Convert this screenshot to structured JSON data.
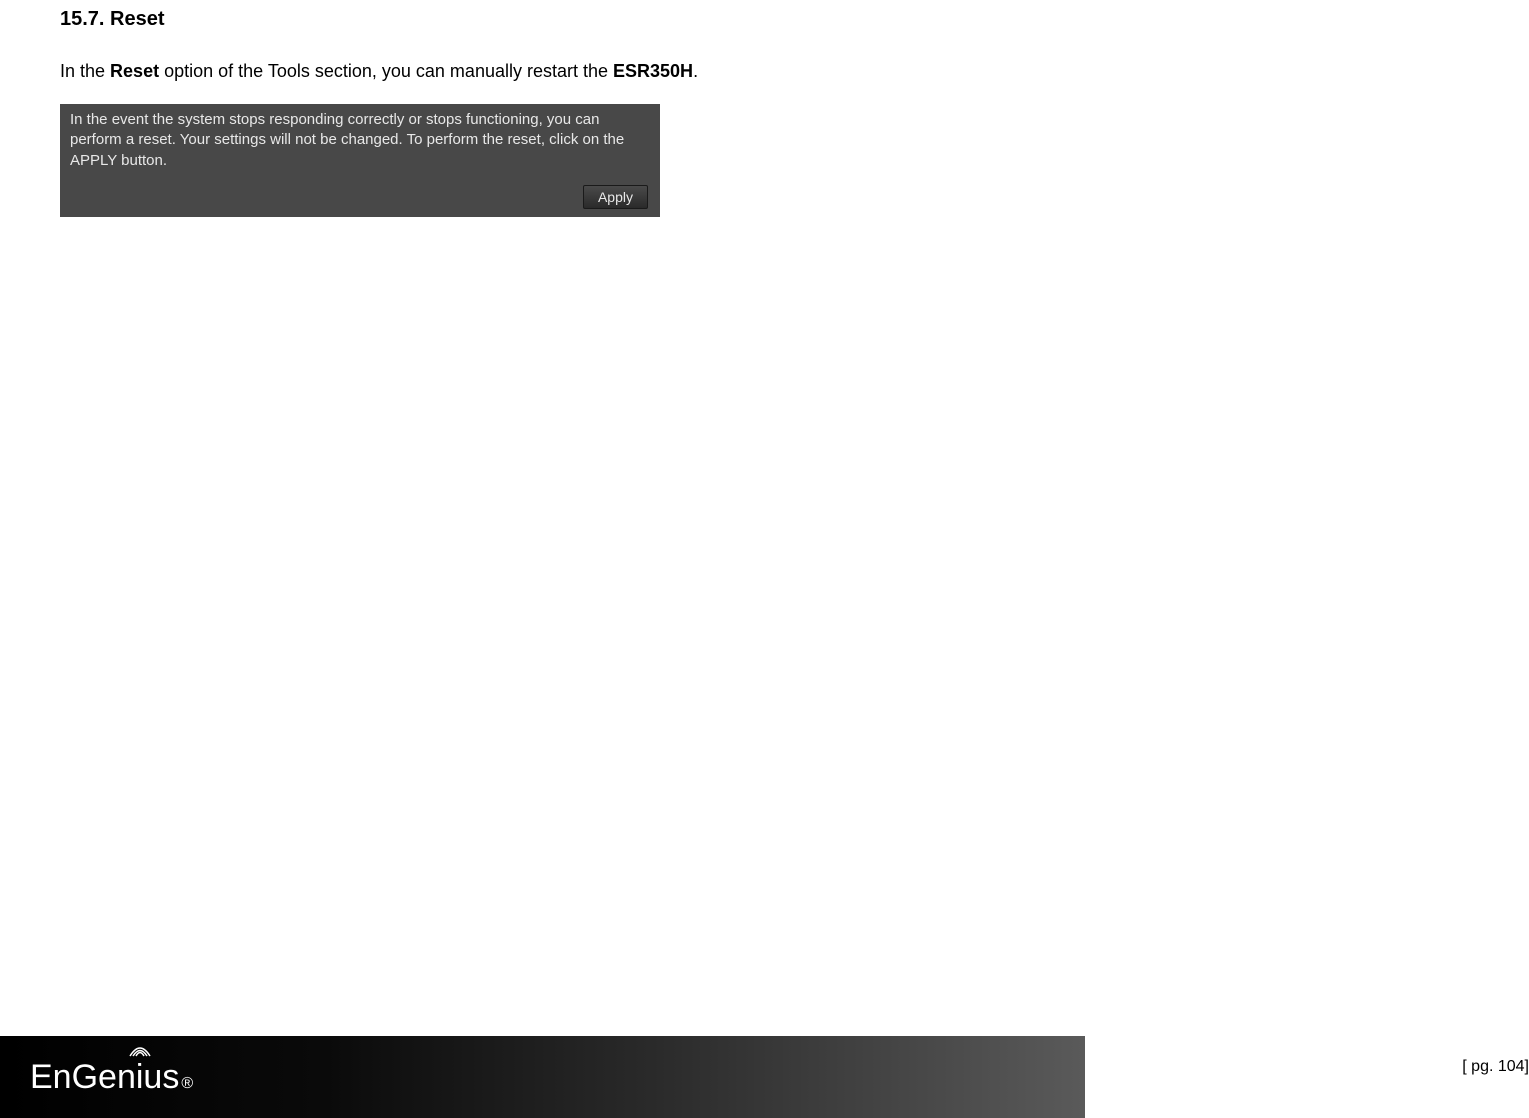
{
  "section": {
    "number": "15.7.",
    "title": "Reset"
  },
  "intro": {
    "prefix": "In the ",
    "bold1": "Reset",
    "middle": " option of the Tools section, you can manually restart the ",
    "bold2": "ESR350H",
    "suffix": "."
  },
  "panel": {
    "text": "In the event the system stops responding correctly or stops functioning, you can perform a reset. Your settings will not be changed. To perform the reset, click on the APPLY button.",
    "button_label": "Apply"
  },
  "footer": {
    "logo_text": "EnGenius",
    "registered": "®"
  },
  "page_number": "[ pg. 104]"
}
